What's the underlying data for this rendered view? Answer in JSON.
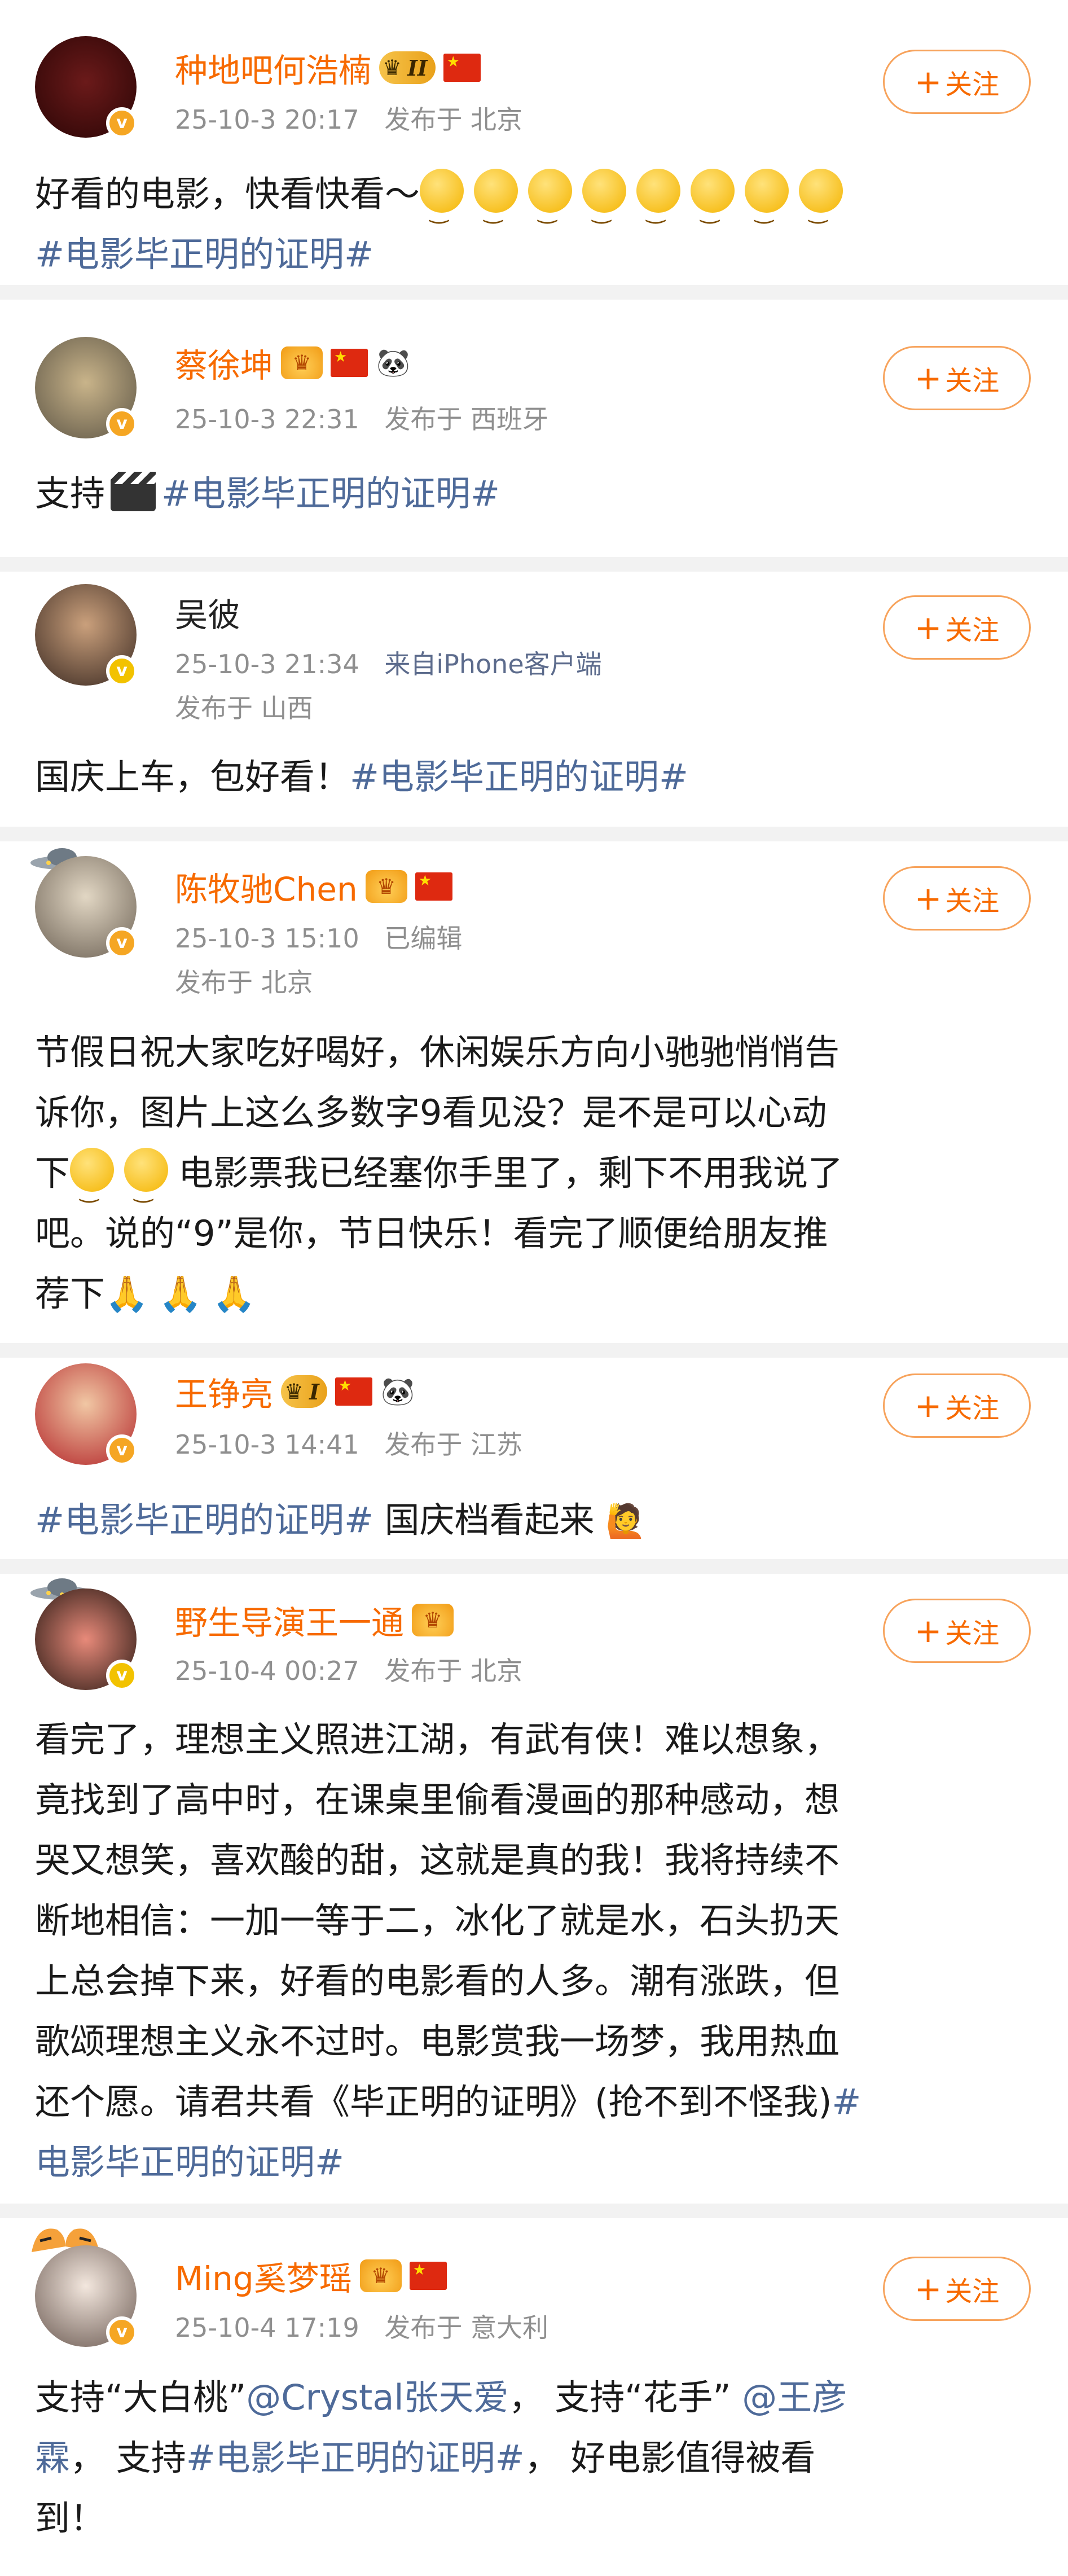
{
  "follow_label": "关注",
  "posts": [
    {
      "name": "种地吧何浩楠",
      "rank": "II",
      "date": "25-10-3 20:17",
      "location": "发布于 北京",
      "text": "好看的电影，快看快看～",
      "hashtag": "#电影毕正明的证明#"
    },
    {
      "name": "蔡徐坤",
      "date": "25-10-3 22:31",
      "location": "发布于 西班牙",
      "text": "支持",
      "hashtag": "#电影毕正明的证明#"
    },
    {
      "name": "吴彼",
      "date": "25-10-3 21:34",
      "client": "来自iPhone客户端",
      "location": "发布于 山西",
      "text": "国庆上车，包好看！",
      "hashtag": "#电影毕正明的证明#"
    },
    {
      "name": "陈牧驰Chen",
      "date": "25-10-3 15:10",
      "edited": "已编辑",
      "location": "发布于 北京",
      "text1": "节假日祝大家吃好喝好，休闲娱乐方向小驰驰悄悄告",
      "text2": "诉你，图片上这么多数字9看见没？是不是可以心动",
      "text3": "电影票我已经塞你手里了，剩下不用我说了",
      "text3_prefix": "下",
      "text4": "吧。说的“9”是你，节日快乐！看完了顺便给朋友推",
      "text5": "荐下"
    },
    {
      "name": "王铮亮",
      "rank": "I",
      "date": "25-10-3 14:41",
      "location": "发布于 江苏",
      "hashtag": "#电影毕正明的证明#",
      "text": "国庆档看起来"
    },
    {
      "name": "野生导演王一通",
      "date": "25-10-4 00:27",
      "location": "发布于 北京",
      "lines": [
        "看完了，理想主义照进江湖，有武有侠！难以想象，",
        "竟找到了高中时，在课桌里偷看漫画的那种感动，想",
        "哭又想笑，喜欢酸的甜，这就是真的我！我将持续不",
        "断地相信：一加一等于二，冰化了就是水，石头扔天",
        "上总会掉下来，好看的电影看的人多。潮有涨跌，但",
        "歌颂理想主义永不过时。电影赏我一场梦，我用热血"
      ],
      "line7": "还个愿。请君共看《毕正明的证明》(抢不到不怪我)",
      "line7_tag": "#",
      "line8_tag": "电影毕正明的证明#"
    },
    {
      "name": "Ming奚梦瑶",
      "date": "25-10-4 17:19",
      "location": "发布于 意大利",
      "l1_a": "支持“大白桃”",
      "l1_mention": "@Crystal张天爱",
      "l1_b": "， 支持“花手”",
      "l1_mention2": "@王彦",
      "l2_mention": "霖",
      "l2_a": "， 支持",
      "l2_tag": "#电影毕正明的证明#",
      "l2_b": "， 好电影值得被看",
      "l3": "到！"
    }
  ],
  "colors": {
    "name": "#f76a00",
    "link": "#4e6a99",
    "meta": "#8f8f8f",
    "follow_border": "#f7a35c"
  }
}
